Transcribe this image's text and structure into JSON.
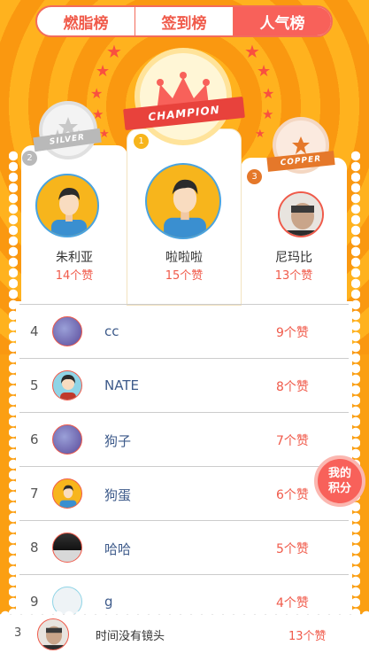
{
  "tabs": [
    {
      "label": "燃脂榜",
      "active": false
    },
    {
      "label": "签到榜",
      "active": false
    },
    {
      "label": "人气榜",
      "active": true
    }
  ],
  "podium": {
    "champion": {
      "medal_text": "CHAMPION",
      "rank": "1",
      "name": "啦啦啦",
      "likes": "15个赞"
    },
    "silver": {
      "medal_text": "SILVER",
      "rank": "2",
      "name": "朱利亚",
      "likes": "14个赞"
    },
    "copper": {
      "medal_text": "COPPER",
      "rank": "3",
      "name": "尼玛比",
      "likes": "13个赞"
    }
  },
  "list": [
    {
      "rank": "4",
      "name": "cc",
      "likes": "9个赞",
      "avatar": "photo-avatar"
    },
    {
      "rank": "5",
      "name": "NATE",
      "likes": "8个赞",
      "avatar": "girl-avatar"
    },
    {
      "rank": "6",
      "name": "狗子",
      "likes": "7个赞",
      "avatar": "photo-avatar"
    },
    {
      "rank": "7",
      "name": "狗蛋",
      "likes": "6个赞",
      "avatar": "boy-avatar"
    },
    {
      "rank": "8",
      "name": "哈哈",
      "likes": "5个赞",
      "avatar": "dark-photo-avatar"
    },
    {
      "rank": "9",
      "name": "g",
      "likes": "4个赞",
      "avatar": "light-photo-avatar"
    }
  ],
  "my_score_button": {
    "line1": "我的",
    "line2": "积分"
  },
  "me": {
    "rank": "3",
    "name": "时间没有镜头",
    "likes": "13个赞"
  },
  "colors": {
    "accent": "#f8615a",
    "background": "#fb9f12",
    "gold": "#f7b51c",
    "silver": "#b9b9b9",
    "copper": "#e5782a"
  }
}
